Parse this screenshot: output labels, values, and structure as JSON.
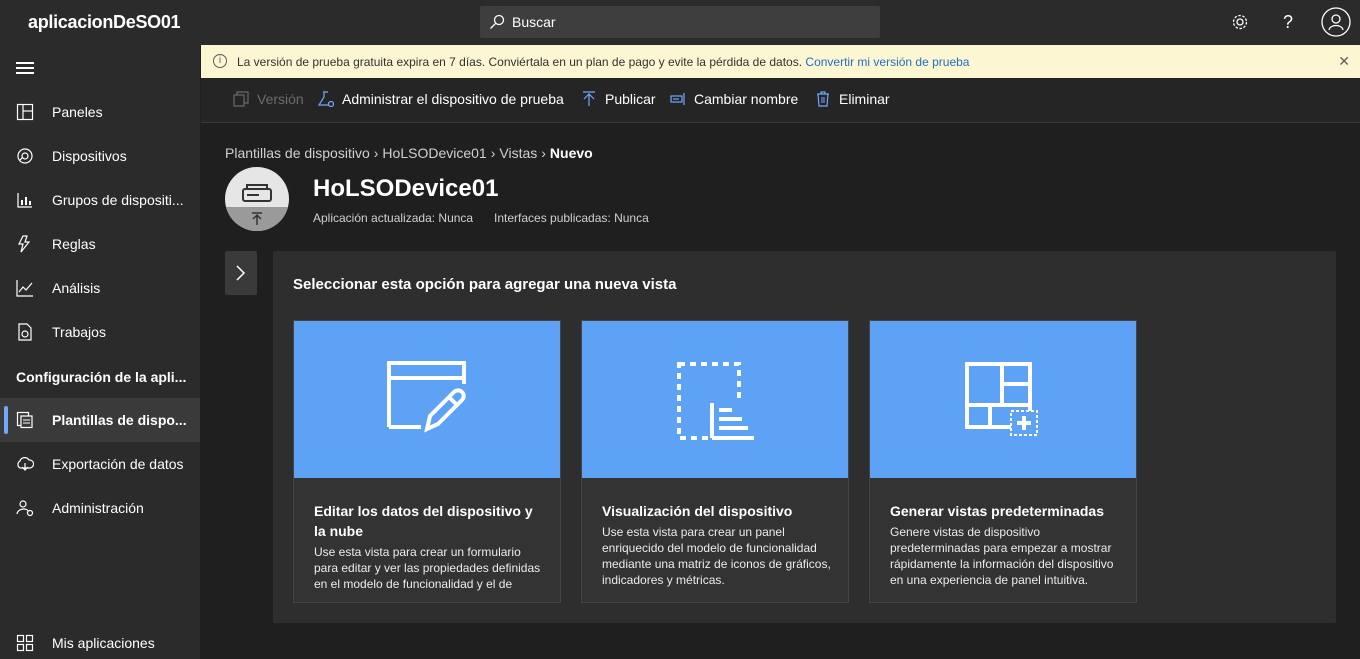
{
  "topbar": {
    "app_title": "aplicacionDeSO01",
    "search_placeholder": "Buscar",
    "icons": [
      "gear-icon",
      "help-icon",
      "account-icon"
    ]
  },
  "sidebar": {
    "items": [
      {
        "label": "Paneles",
        "icon": "dashboard-icon"
      },
      {
        "label": "Dispositivos",
        "icon": "devices-icon"
      },
      {
        "label": "Grupos de dispositi...",
        "icon": "device-groups-icon"
      },
      {
        "label": "Reglas",
        "icon": "rules-icon"
      },
      {
        "label": "Análisis",
        "icon": "analytics-icon"
      },
      {
        "label": "Trabajos",
        "icon": "jobs-icon"
      }
    ],
    "section_label": "Configuración de la apli...",
    "config_items": [
      {
        "label": "Plantillas de dispo...",
        "icon": "device-templates-icon",
        "active": true
      },
      {
        "label": "Exportación de datos",
        "icon": "data-export-icon"
      },
      {
        "label": "Administración",
        "icon": "administration-icon"
      }
    ],
    "footer_item": {
      "label": "Mis aplicaciones",
      "icon": "my-apps-icon"
    }
  },
  "banner": {
    "message": "La versión de prueba gratuita expira en 7 días. Conviértala en un plan de pago y evite la pérdida de datos.",
    "link": "Convertir mi versión de prueba"
  },
  "commands": {
    "version": "Versión",
    "manage_test_device": "Administrar el dispositivo de prueba",
    "publish": "Publicar",
    "rename": "Cambiar nombre",
    "delete": "Eliminar"
  },
  "breadcrumb": [
    "Plantillas de dispositivo",
    "HoLSODevice01",
    "Vistas",
    "Nuevo"
  ],
  "device": {
    "title": "HoLSODevice01",
    "app_updated": "Aplicación actualizada: Nunca",
    "interfaces_published": "Interfaces publicadas: Nunca"
  },
  "panel": {
    "title": "Seleccionar esta opción para agregar una nueva vista",
    "cards": [
      {
        "title": "Editar los datos del dispositivo y la nube",
        "description": "Use esta vista para crear un formulario para editar y ver las propiedades definidas en el modelo de funcionalidad y el de",
        "icon": "edit-form-icon"
      },
      {
        "title": "Visualización del dispositivo",
        "description": "Use esta vista para crear un panel enriquecido del modelo de funcionalidad mediante una matriz de iconos de gráficos, indicadores y métricas.",
        "icon": "visualization-icon"
      },
      {
        "title": "Generar vistas predeterminadas",
        "description": "Genere vistas de dispositivo predeterminadas para empezar a mostrar rápidamente la información del dispositivo en una experiencia de panel intuitiva.",
        "icon": "default-views-icon"
      }
    ]
  },
  "colors": {
    "card_hero": "#5ea2f5",
    "banner_bg": "#fdf6d3",
    "accent": "#6fa8ff",
    "link": "#1f6fc5"
  }
}
